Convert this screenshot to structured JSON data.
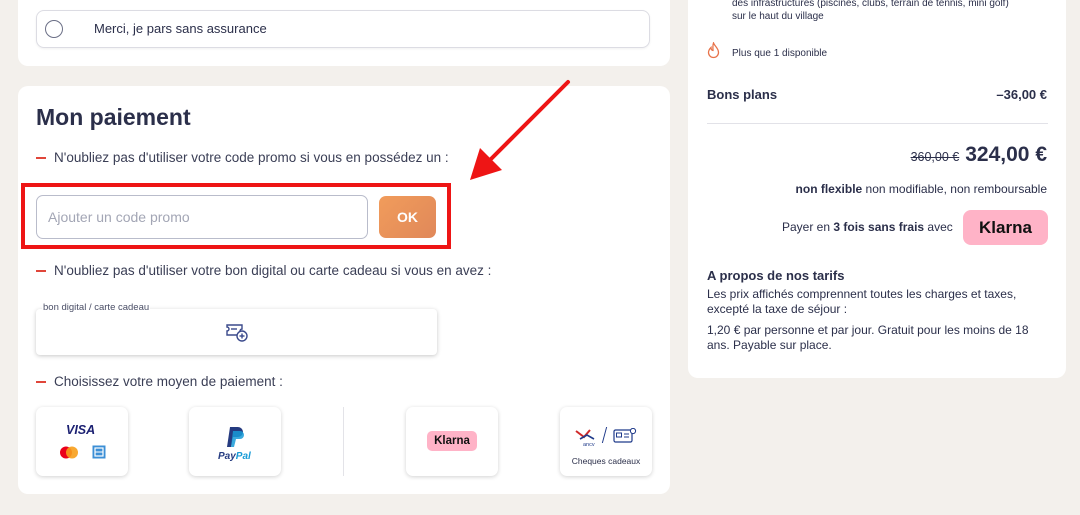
{
  "insurance": {
    "option_label": "Merci, je pars sans assurance"
  },
  "payment": {
    "title": "Mon paiement",
    "promo_hint": "N'oubliez pas d'utiliser votre code promo si vous en possédez un :",
    "promo_placeholder": "Ajouter un code promo",
    "ok_label": "OK",
    "gift_hint": "N'oubliez pas d'utiliser votre bon digital ou carte cadeau si vous en avez :",
    "gift_label": "bon digital / carte cadeau",
    "method_hint": "Choisissez votre moyen de paiement :",
    "methods": {
      "card_visa": "VISA",
      "paypal_pay": "Pay",
      "paypal_pal": "Pal",
      "klarna": "Klarna",
      "ancv": "ancv",
      "cheques_label": "Cheques cadeaux"
    }
  },
  "summary": {
    "amenities_line1": "des infrastructures (piscines, clubs, terrain de tennis, mini golf)",
    "amenities_line2": "sur le haut du village",
    "availability": "Plus que 1 disponible",
    "deals_label": "Bons plans",
    "deals_value": "–36,00 €",
    "old_price": "360,00 €",
    "new_price": "324,00 €",
    "flex_bold": "non flexible",
    "flex_rest": " non modifiable, non remboursable",
    "klarna_pre": "Payer en ",
    "klarna_bold": "3 fois sans frais",
    "klarna_post": " avec",
    "klarna_badge": "Klarna",
    "pricing_title": "A propos de nos tarifs",
    "pricing_p1": "Les prix affichés comprennent toutes les charges et taxes, excepté la taxe de séjour :",
    "pricing_p2": "1,20 € par personne et par jour. Gratuit pour les moins de 18 ans. Payable sur place."
  },
  "colors": {
    "accent_orange": "#e8905a",
    "highlight_red": "#ee1515",
    "klarna_pink": "#ffb3c7",
    "text_dark": "#2b2f4a"
  }
}
